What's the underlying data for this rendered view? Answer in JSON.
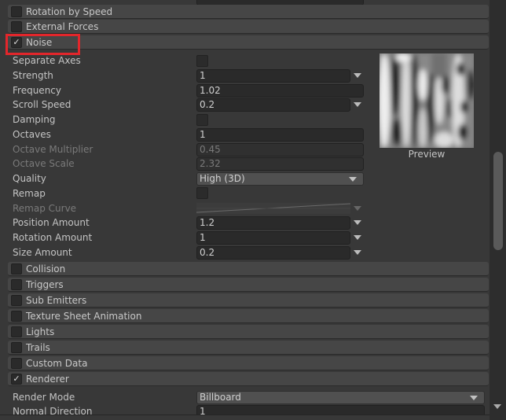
{
  "modules_above": [
    {
      "label": "Rotation by Speed",
      "enabled": false
    },
    {
      "label": "External Forces",
      "enabled": false
    }
  ],
  "noise": {
    "label": "Noise",
    "enabled": true,
    "properties": {
      "separate_axes": {
        "label": "Separate Axes",
        "checked": false
      },
      "strength": {
        "label": "Strength",
        "value": "1"
      },
      "frequency": {
        "label": "Frequency",
        "value": "1.02"
      },
      "scroll_speed": {
        "label": "Scroll Speed",
        "value": "0.2"
      },
      "damping": {
        "label": "Damping",
        "checked": false
      },
      "octaves": {
        "label": "Octaves",
        "value": "1"
      },
      "octave_multiplier": {
        "label": "Octave Multiplier",
        "value": "0.45"
      },
      "octave_scale": {
        "label": "Octave Scale",
        "value": "2.32"
      },
      "quality": {
        "label": "Quality",
        "value": "High (3D)"
      },
      "remap": {
        "label": "Remap",
        "checked": false
      },
      "remap_curve": {
        "label": "Remap Curve"
      },
      "position_amount": {
        "label": "Position Amount",
        "value": "1.2"
      },
      "rotation_amount": {
        "label": "Rotation Amount",
        "value": "1"
      },
      "size_amount": {
        "label": "Size Amount",
        "value": "0.2"
      }
    },
    "preview_label": "Preview"
  },
  "modules_below": [
    {
      "label": "Collision",
      "enabled": false
    },
    {
      "label": "Triggers",
      "enabled": false
    },
    {
      "label": "Sub Emitters",
      "enabled": false
    },
    {
      "label": "Texture Sheet Animation",
      "enabled": false
    },
    {
      "label": "Lights",
      "enabled": false
    },
    {
      "label": "Trails",
      "enabled": false
    },
    {
      "label": "Custom Data",
      "enabled": false
    },
    {
      "label": "Renderer",
      "enabled": true
    }
  ],
  "renderer": {
    "render_mode": {
      "label": "Render Mode",
      "value": "Billboard"
    },
    "normal_direction": {
      "label": "Normal Direction",
      "value": "1"
    }
  },
  "colors": {
    "highlight": "#e3262b",
    "panel": "#383838",
    "header": "#464646"
  }
}
